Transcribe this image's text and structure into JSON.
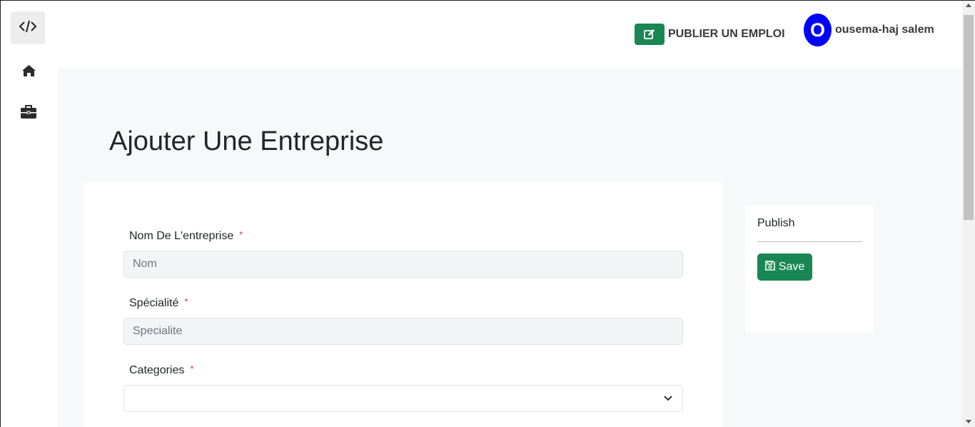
{
  "sidebar": {
    "logo_icon": "code-icon",
    "items": [
      {
        "icon": "home-icon"
      },
      {
        "icon": "briefcase-icon"
      }
    ]
  },
  "header": {
    "publish_job_label": "PUBLIER UN EMPLOI",
    "publish_job_icon": "edit-icon",
    "user": {
      "avatar_initial": "O",
      "avatar_color": "#0000ff",
      "name": "ousema-haj salem"
    }
  },
  "main": {
    "title": "Ajouter Une Entreprise",
    "form": {
      "fields": [
        {
          "label": "Nom De L'entreprise",
          "required": "*",
          "placeholder": "Nom",
          "value": ""
        },
        {
          "label": "Spécialité",
          "required": "*",
          "placeholder": "Specialite",
          "value": ""
        },
        {
          "label": "Categories",
          "required": "*",
          "selected": ""
        }
      ]
    },
    "publish_panel": {
      "title": "Publish",
      "save_label": "Save",
      "save_icon": "floppy-disk-icon"
    }
  },
  "colors": {
    "accent_green": "#198754",
    "required_red": "#dc3545",
    "main_bg": "#f7f8f9"
  }
}
